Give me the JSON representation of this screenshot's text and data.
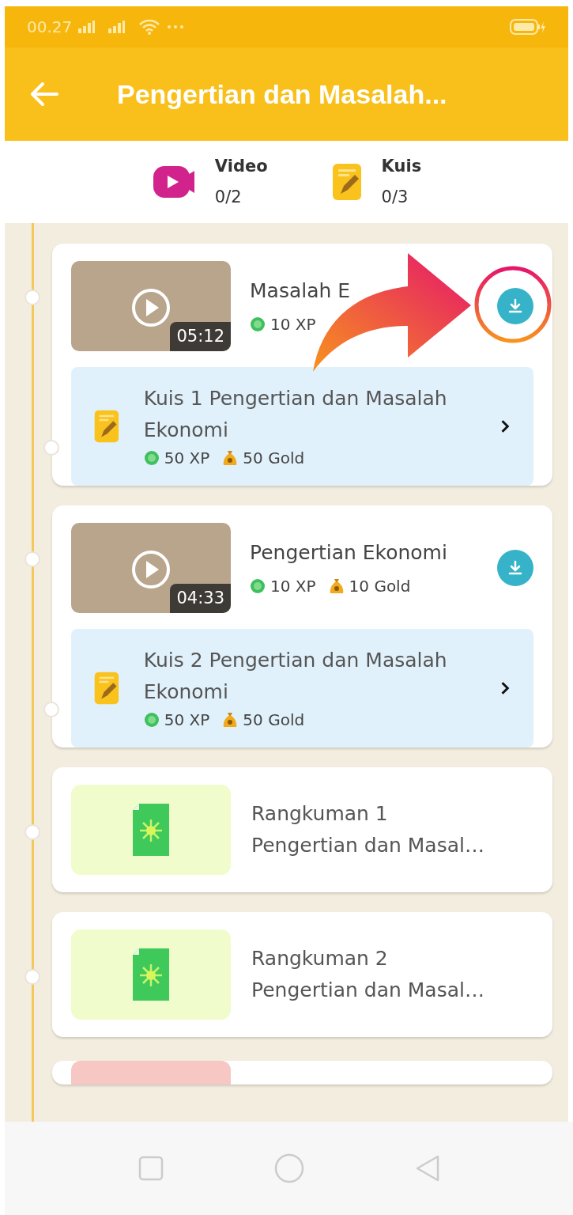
{
  "status_bar": {
    "time": "00.27"
  },
  "header": {
    "title": "Pengertian dan Masalah..."
  },
  "summary": [
    {
      "kind": "video",
      "label": "Video",
      "count": "0/2"
    },
    {
      "kind": "quiz",
      "label": "Kuis",
      "count": "0/3"
    }
  ],
  "items": [
    {
      "kind": "video",
      "title": "Masalah E",
      "duration": "05:12",
      "rewards": [
        {
          "kind": "xp",
          "text": "10 XP"
        }
      ],
      "quiz": {
        "title": "Kuis 1 Pengertian dan Masalah Ekonomi",
        "rewards": [
          {
            "kind": "xp",
            "text": "50 XP"
          },
          {
            "kind": "gold",
            "text": "50 Gold"
          }
        ]
      }
    },
    {
      "kind": "video",
      "title": "Pengertian Ekonomi",
      "duration": "04:33",
      "rewards": [
        {
          "kind": "xp",
          "text": "10 XP"
        },
        {
          "kind": "gold",
          "text": "10 Gold"
        }
      ],
      "quiz": {
        "title": "Kuis 2 Pengertian dan Masalah Ekonomi",
        "rewards": [
          {
            "kind": "xp",
            "text": "50 XP"
          },
          {
            "kind": "gold",
            "text": "50 Gold"
          }
        ]
      }
    },
    {
      "kind": "summary",
      "title": "Rangkuman 1",
      "subtitle": "Pengertian dan Masal…"
    },
    {
      "kind": "summary",
      "title": "Rangkuman 2",
      "subtitle": "Pengertian dan Masal…"
    },
    {
      "kind": "partial"
    }
  ],
  "annotation": {
    "kind": "arrow-ring"
  }
}
